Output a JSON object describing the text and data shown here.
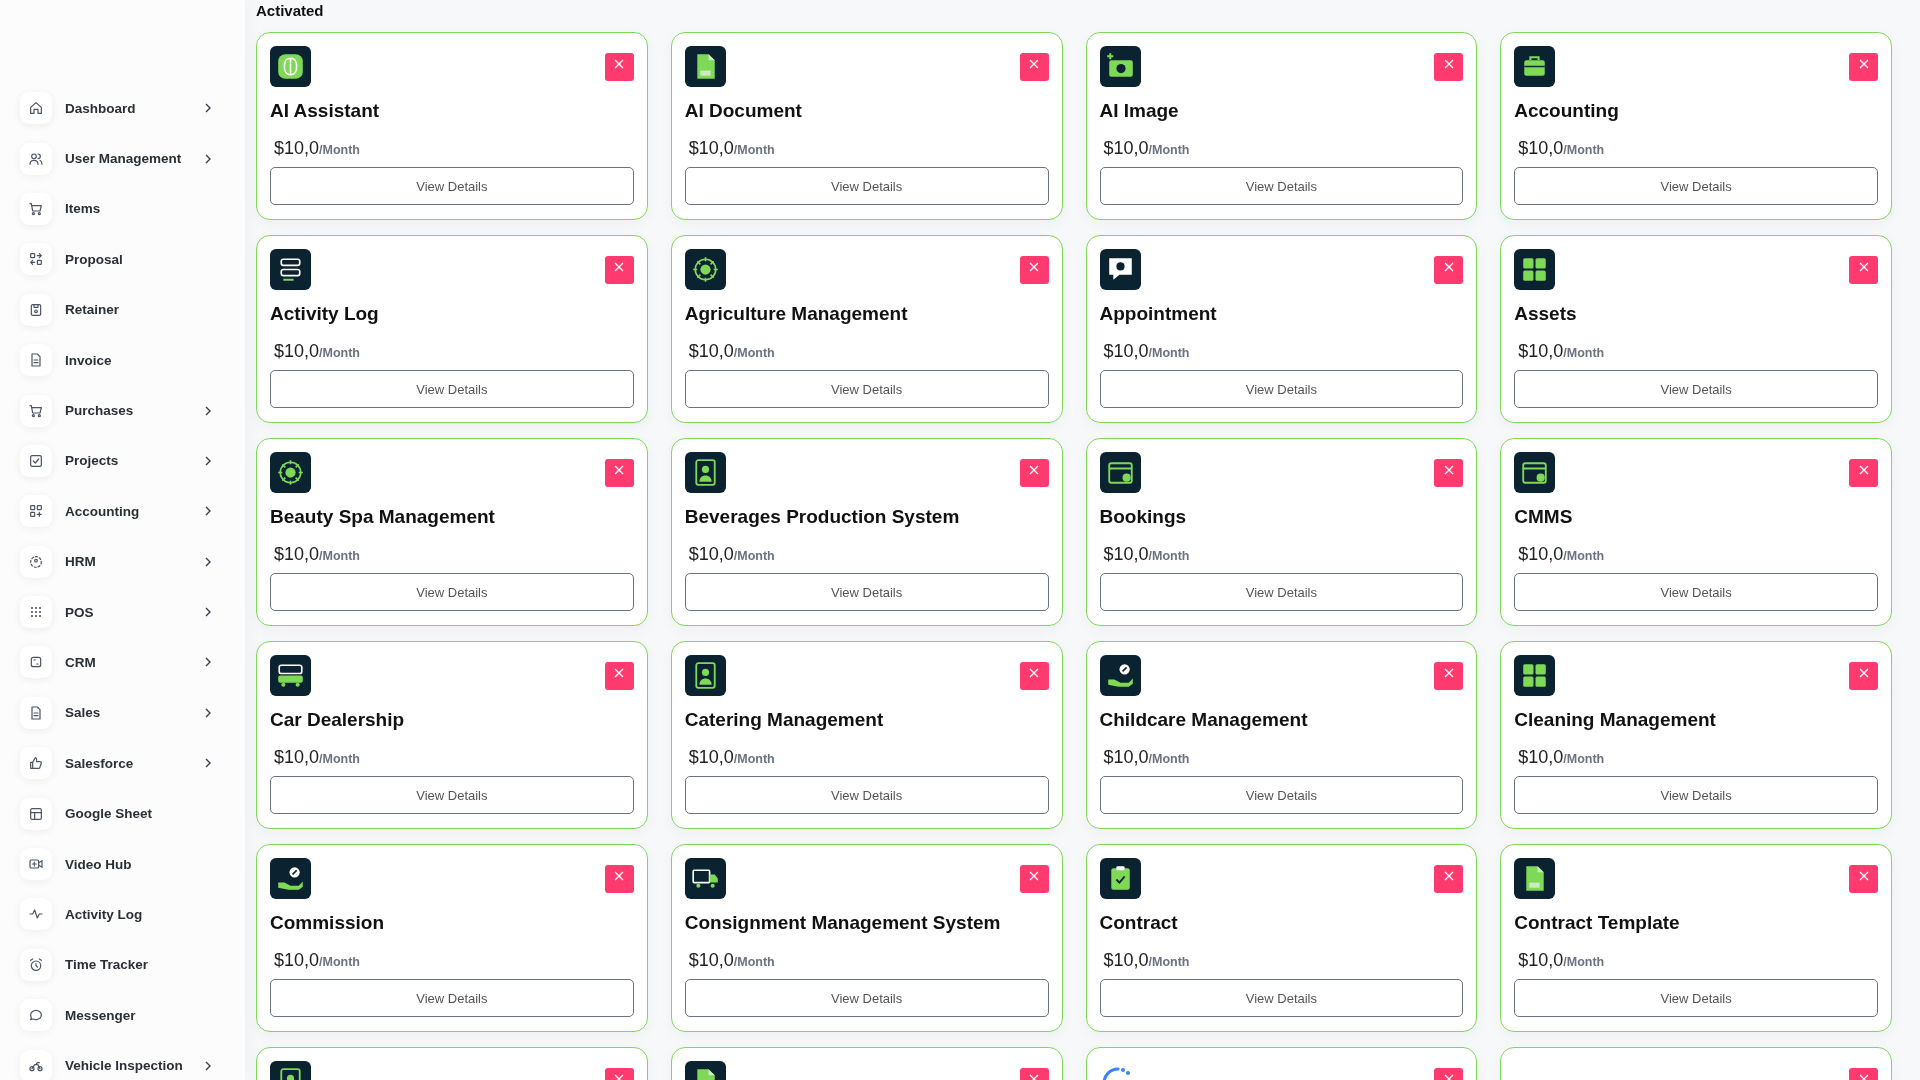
{
  "sidebar": {
    "items": [
      {
        "label": "Dashboard",
        "kind": "home",
        "has_submenu": true
      },
      {
        "label": "User Management",
        "kind": "users",
        "has_submenu": true
      },
      {
        "label": "Items",
        "kind": "cart",
        "has_submenu": false
      },
      {
        "label": "Proposal",
        "kind": "swap",
        "has_submenu": false
      },
      {
        "label": "Retainer",
        "kind": "disk",
        "has_submenu": false
      },
      {
        "label": "Invoice",
        "kind": "file",
        "has_submenu": false
      },
      {
        "label": "Purchases",
        "kind": "cart",
        "has_submenu": true
      },
      {
        "label": "Projects",
        "kind": "check",
        "has_submenu": true
      },
      {
        "label": "Accounting",
        "kind": "gridplus",
        "has_submenu": true
      },
      {
        "label": "HRM",
        "kind": "dashed",
        "has_submenu": true
      },
      {
        "label": "POS",
        "kind": "dots",
        "has_submenu": true
      },
      {
        "label": "CRM",
        "kind": "frame",
        "has_submenu": true
      },
      {
        "label": "Sales",
        "kind": "file",
        "has_submenu": true
      },
      {
        "label": "Salesforce",
        "kind": "thumb",
        "has_submenu": true
      },
      {
        "label": "Google Sheet",
        "kind": "table",
        "has_submenu": false
      },
      {
        "label": "Video Hub",
        "kind": "video",
        "has_submenu": false
      },
      {
        "label": "Activity Log",
        "kind": "pulse",
        "has_submenu": false
      },
      {
        "label": "Time Tracker",
        "kind": "clock",
        "has_submenu": false
      },
      {
        "label": "Messenger",
        "kind": "chat",
        "has_submenu": false
      },
      {
        "label": "Vehicle Inspection",
        "kind": "bike",
        "has_submenu": true
      }
    ]
  },
  "section_title": "Activated",
  "cards": [
    {
      "name": "AI Assistant",
      "kind": "brain",
      "price": "$10,0",
      "period": "/Month",
      "button": "View Details"
    },
    {
      "name": "AI Document",
      "kind": "document",
      "price": "$10,0",
      "period": "/Month",
      "button": "View Details"
    },
    {
      "name": "AI Image",
      "kind": "camera",
      "price": "$10,0",
      "period": "/Month",
      "button": "View Details"
    },
    {
      "name": "Accounting",
      "kind": "briefcase",
      "price": "$10,0",
      "period": "/Month",
      "button": "View Details"
    },
    {
      "name": "Activity Log",
      "kind": "list",
      "price": "$10,0",
      "period": "/Month",
      "button": "View Details"
    },
    {
      "name": "Agriculture Management",
      "kind": "flower",
      "price": "$10,0",
      "period": "/Month",
      "button": "View Details"
    },
    {
      "name": "Appointment",
      "kind": "chat",
      "price": "$10,0",
      "period": "/Month",
      "button": "View Details"
    },
    {
      "name": "Assets",
      "kind": "grid",
      "price": "$10,0",
      "period": "/Month",
      "button": "View Details"
    },
    {
      "name": "Beauty Spa Management",
      "kind": "flower",
      "price": "$10,0",
      "period": "/Month",
      "button": "View Details"
    },
    {
      "name": "Beverages Production System",
      "kind": "person",
      "price": "$10,0",
      "period": "/Month",
      "button": "View Details"
    },
    {
      "name": "Bookings",
      "kind": "calendar",
      "price": "$10,0",
      "period": "/Month",
      "button": "View Details"
    },
    {
      "name": "CMMS",
      "kind": "calendar",
      "price": "$10,0",
      "period": "/Month",
      "button": "View Details"
    },
    {
      "name": "Car Dealership",
      "kind": "car",
      "price": "$10,0",
      "period": "/Month",
      "button": "View Details"
    },
    {
      "name": "Catering Management",
      "kind": "person",
      "price": "$10,0",
      "period": "/Month",
      "button": "View Details"
    },
    {
      "name": "Childcare Management",
      "kind": "hand",
      "price": "$10,0",
      "period": "/Month",
      "button": "View Details"
    },
    {
      "name": "Cleaning Management",
      "kind": "grid",
      "price": "$10,0",
      "period": "/Month",
      "button": "View Details"
    },
    {
      "name": "Commission",
      "kind": "hand",
      "price": "$10,0",
      "period": "/Month",
      "button": "View Details"
    },
    {
      "name": "Consignment Management System",
      "kind": "truck",
      "price": "$10,0",
      "period": "/Month",
      "button": "View Details"
    },
    {
      "name": "Contract",
      "kind": "clipboard",
      "price": "$10,0",
      "period": "/Month",
      "button": "View Details"
    },
    {
      "name": "Contract Template",
      "kind": "document",
      "price": "$10,0",
      "period": "/Month",
      "button": "View Details"
    },
    {
      "kind": "person"
    },
    {
      "kind": "document"
    },
    {
      "kind": "arc"
    },
    {
      "kind": "none"
    }
  ]
}
